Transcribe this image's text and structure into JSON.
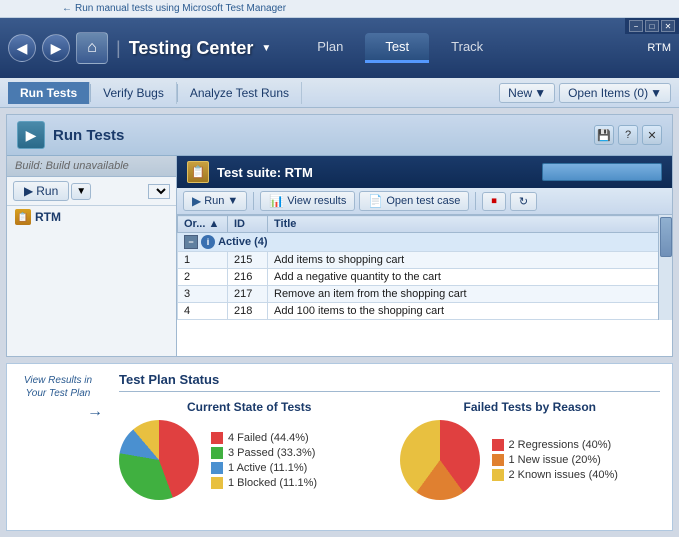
{
  "annotation": {
    "top": "Run manual tests using Microsoft Test Manager",
    "bottom_line1": "View Results in",
    "bottom_line2": "Your Test Plan"
  },
  "window": {
    "title": "Testing Center",
    "min": "−",
    "max": "□",
    "close": "✕",
    "rtm": "RTM"
  },
  "nav": {
    "plan": "Plan",
    "test": "Test",
    "track": "Track"
  },
  "toolbar": {
    "run_tests": "Run Tests",
    "verify_bugs": "Verify Bugs",
    "analyze_test_runs": "Analyze Test Runs",
    "new": "New",
    "open_items": "Open Items (0)"
  },
  "panel": {
    "title": "Run Tests",
    "build_label": "Build:",
    "build_value": "Build unavailable",
    "suite_title": "Test suite:  RTM",
    "run_btn": "Run",
    "view_results": "View results",
    "open_test_case": "Open test case"
  },
  "tree": {
    "item": "RTM"
  },
  "table": {
    "headers": [
      "Or...",
      "ID",
      "Title"
    ],
    "group": "Active (4)",
    "rows": [
      {
        "order": "1",
        "id": "215",
        "title": "Add items to shopping cart"
      },
      {
        "order": "2",
        "id": "216",
        "title": "Add a negative quantity to the cart"
      },
      {
        "order": "3",
        "id": "217",
        "title": "Remove an item from the shopping cart"
      },
      {
        "order": "4",
        "id": "218",
        "title": "Add 100 items to the shopping cart"
      }
    ]
  },
  "status": {
    "title": "Test Plan Status",
    "current_state_label": "Current State of Tests",
    "failed_tests_label": "Failed Tests by Reason",
    "chart1": {
      "segments": [
        {
          "color": "#e04040",
          "label": "4 Failed (44.4%)"
        },
        {
          "color": "#40b040",
          "label": "3 Passed (33.3%)"
        },
        {
          "color": "#4a90d0",
          "label": "1 Active (11.1%)"
        },
        {
          "color": "#e8c040",
          "label": "1 Blocked (11.1%)"
        }
      ]
    },
    "chart2": {
      "segments": [
        {
          "color": "#e04040",
          "label": "2 Regressions (40%)"
        },
        {
          "color": "#e08030",
          "label": "1 New issue (20%)"
        },
        {
          "color": "#e8c040",
          "label": "2 Known issues (40%)"
        }
      ]
    }
  }
}
